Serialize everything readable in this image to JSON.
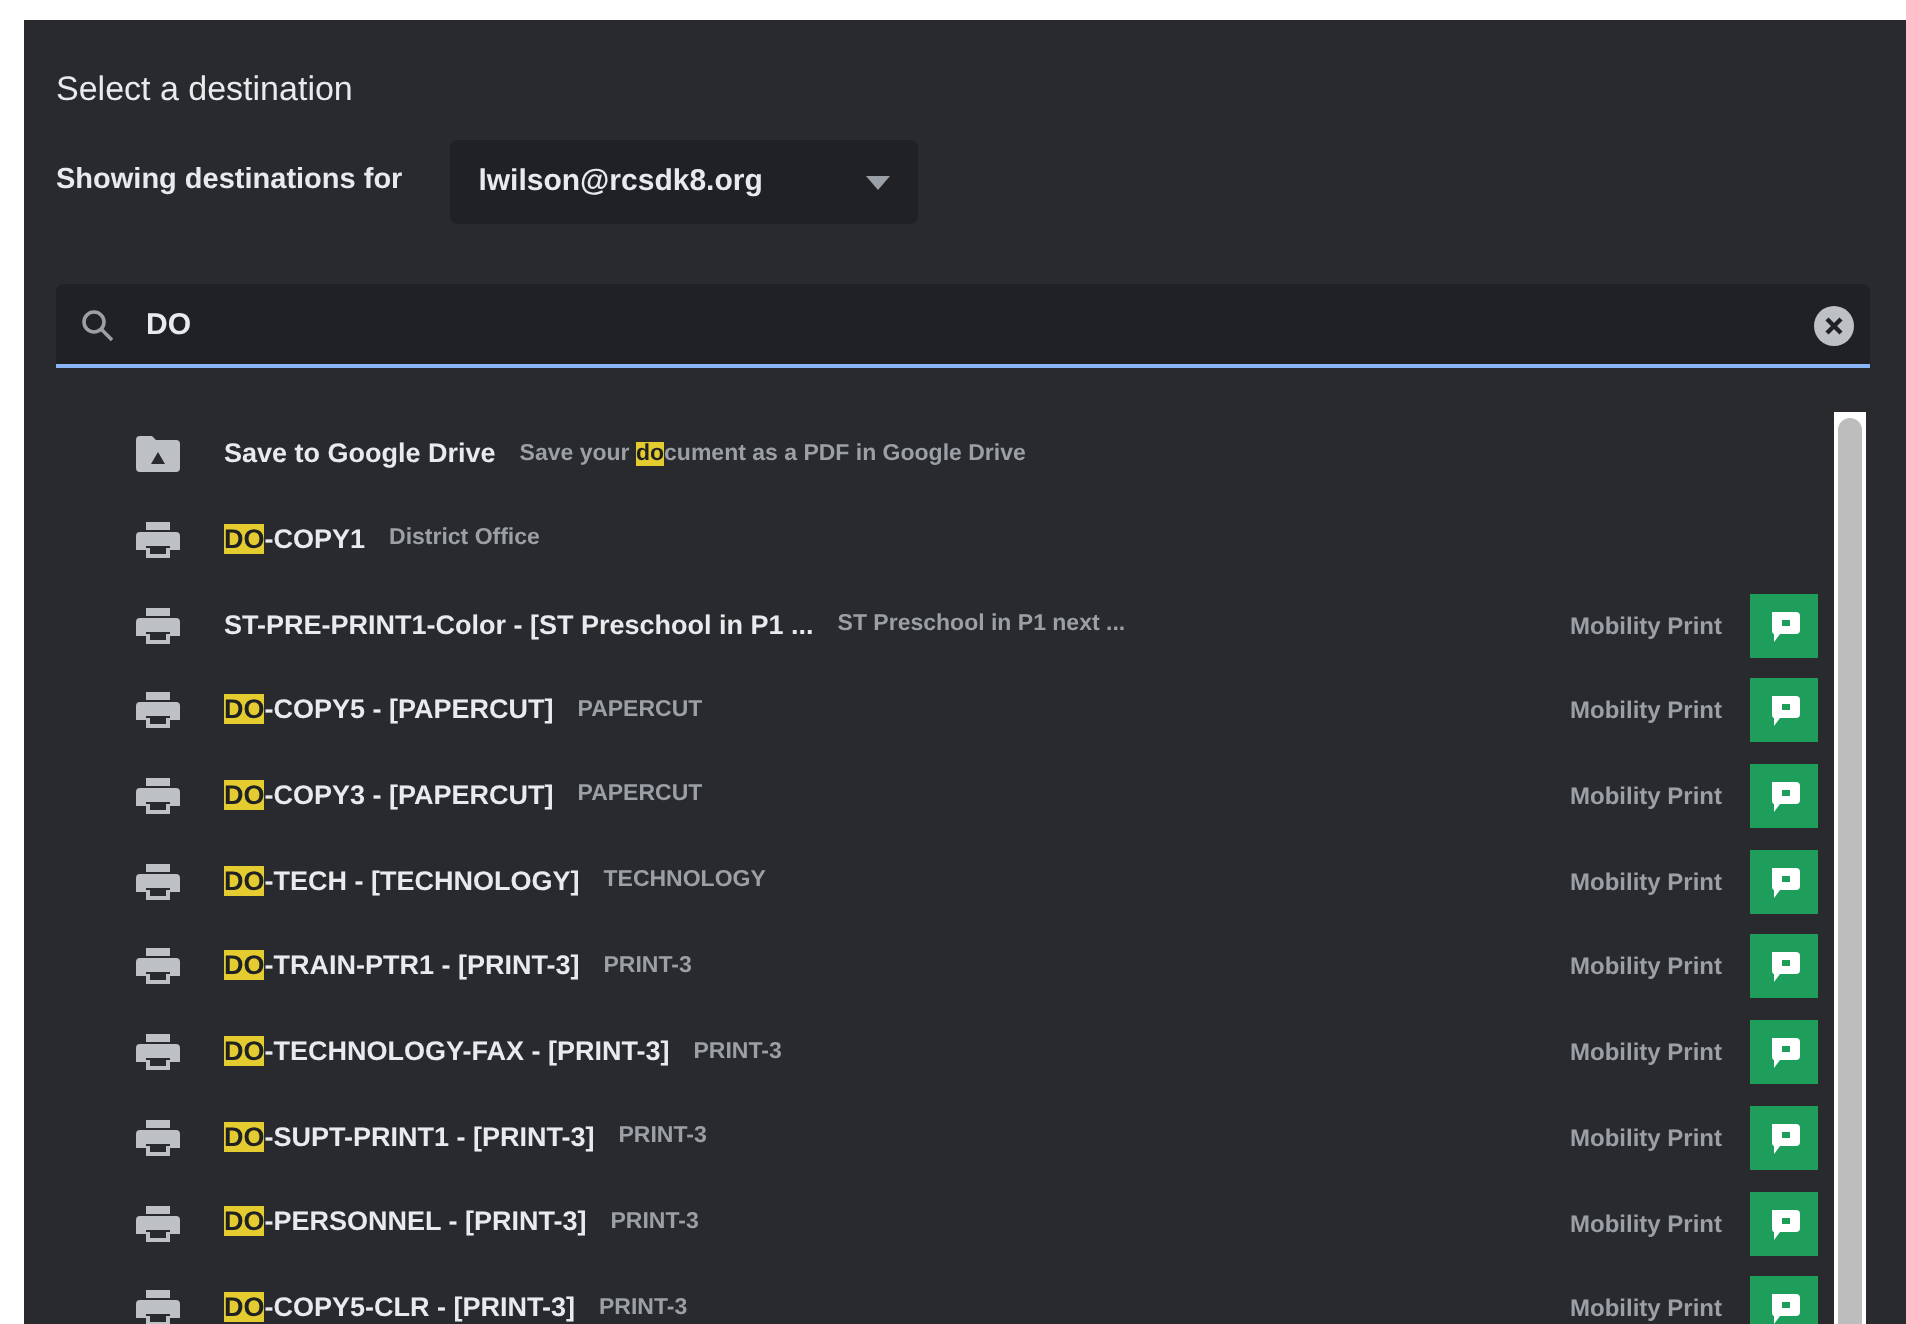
{
  "dialog": {
    "title": "Select a destination",
    "account_label": "Showing destinations for",
    "account_dropdown": {
      "value": "lwilson@rcsdk8.org"
    },
    "search": {
      "value": "DO"
    },
    "destinations": [
      {
        "kind": "drive",
        "name": [
          {
            "text": "Save to Google Drive",
            "highlight": false
          }
        ],
        "description": [
          {
            "text": "Save your ",
            "highlight": false
          },
          {
            "text": "do",
            "highlight": true
          },
          {
            "text": "cument as a PDF in Google Drive",
            "highlight": false
          }
        ]
      },
      {
        "kind": "printer",
        "name": [
          {
            "text": "DO",
            "highlight": true
          },
          {
            "text": "-COPY1",
            "highlight": false
          }
        ],
        "description": [
          {
            "text": "District Office",
            "highlight": false
          }
        ]
      },
      {
        "kind": "printer",
        "name": [
          {
            "text": "ST-PRE-PRINT1-Color - [ST Preschool in P1 ...",
            "highlight": false
          }
        ],
        "description": [
          {
            "text": "ST Preschool in P1 next ...",
            "highlight": false
          }
        ],
        "provider": "Mobility Print"
      },
      {
        "kind": "printer",
        "name": [
          {
            "text": "DO",
            "highlight": true
          },
          {
            "text": "-COPY5 - [PAPERCUT]",
            "highlight": false
          }
        ],
        "description": [
          {
            "text": "PAPERCUT",
            "highlight": false
          }
        ],
        "provider": "Mobility Print"
      },
      {
        "kind": "printer",
        "name": [
          {
            "text": "DO",
            "highlight": true
          },
          {
            "text": "-COPY3 - [PAPERCUT]",
            "highlight": false
          }
        ],
        "description": [
          {
            "text": "PAPERCUT",
            "highlight": false
          }
        ],
        "provider": "Mobility Print"
      },
      {
        "kind": "printer",
        "name": [
          {
            "text": "DO",
            "highlight": true
          },
          {
            "text": "-TECH - [TECHNOLOGY]",
            "highlight": false
          }
        ],
        "description": [
          {
            "text": "TECHNOLOGY",
            "highlight": false
          }
        ],
        "provider": "Mobility Print"
      },
      {
        "kind": "printer",
        "name": [
          {
            "text": "DO",
            "highlight": true
          },
          {
            "text": "-TRAIN-PTR1 - [PRINT-3]",
            "highlight": false
          }
        ],
        "description": [
          {
            "text": "PRINT-3",
            "highlight": false
          }
        ],
        "provider": "Mobility Print"
      },
      {
        "kind": "printer",
        "name": [
          {
            "text": "DO",
            "highlight": true
          },
          {
            "text": "-TECHNOLOGY-FAX - [PRINT-3]",
            "highlight": false
          }
        ],
        "description": [
          {
            "text": "PRINT-3",
            "highlight": false
          }
        ],
        "provider": "Mobility Print"
      },
      {
        "kind": "printer",
        "name": [
          {
            "text": "DO",
            "highlight": true
          },
          {
            "text": "-SUPT-PRINT1 - [PRINT-3]",
            "highlight": false
          }
        ],
        "description": [
          {
            "text": "PRINT-3",
            "highlight": false
          }
        ],
        "provider": "Mobility Print"
      },
      {
        "kind": "printer",
        "name": [
          {
            "text": "DO",
            "highlight": true
          },
          {
            "text": "-PERSONNEL - [PRINT-3]",
            "highlight": false
          }
        ],
        "description": [
          {
            "text": "PRINT-3",
            "highlight": false
          }
        ],
        "provider": "Mobility Print"
      },
      {
        "kind": "printer",
        "name": [
          {
            "text": "DO",
            "highlight": true
          },
          {
            "text": "-COPY5-CLR - [PRINT-3]",
            "highlight": false
          }
        ],
        "description": [
          {
            "text": "PRINT-3",
            "highlight": false
          }
        ],
        "provider": "Mobility Print"
      }
    ]
  }
}
